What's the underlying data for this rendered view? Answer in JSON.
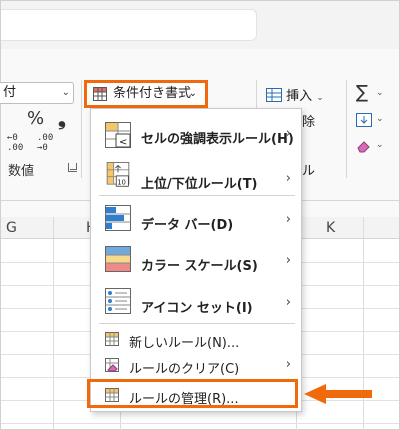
{
  "ribbon": {
    "number_format_value": "付",
    "percent_symbol": "%",
    "comma_symbol": "❟",
    "number_group_label": "数値",
    "conditional_formatting_label": "条件付き書式",
    "insert_label": "挿入",
    "delete_label": "除",
    "format_label": "ル",
    "sigma_symbol": "∑"
  },
  "sheet": {
    "column_headers": [
      "G",
      "H",
      "K"
    ]
  },
  "menu": {
    "items": [
      {
        "label": "セルの強調表示ルール(H)",
        "icon": "highlight-cells-rules-icon"
      },
      {
        "label": "上位/下位ルール(T)",
        "icon": "top-bottom-rules-icon"
      },
      {
        "label": "データ バー(D)",
        "icon": "data-bars-icon"
      },
      {
        "label": "カラー スケール(S)",
        "icon": "color-scales-icon"
      },
      {
        "label": "アイコン セット(I)",
        "icon": "icon-sets-icon"
      }
    ],
    "small_items": [
      {
        "label": "新しいルール(N)...",
        "icon": "new-rule-icon"
      },
      {
        "label": "ルールのクリア(C)",
        "icon": "clear-rules-icon"
      },
      {
        "label": "ルールの管理(R)...",
        "icon": "manage-rules-icon"
      }
    ],
    "submenu_chevron": "›",
    "dropdown_chevron": "⌄"
  },
  "colors": {
    "highlight": "#f06a0c"
  }
}
